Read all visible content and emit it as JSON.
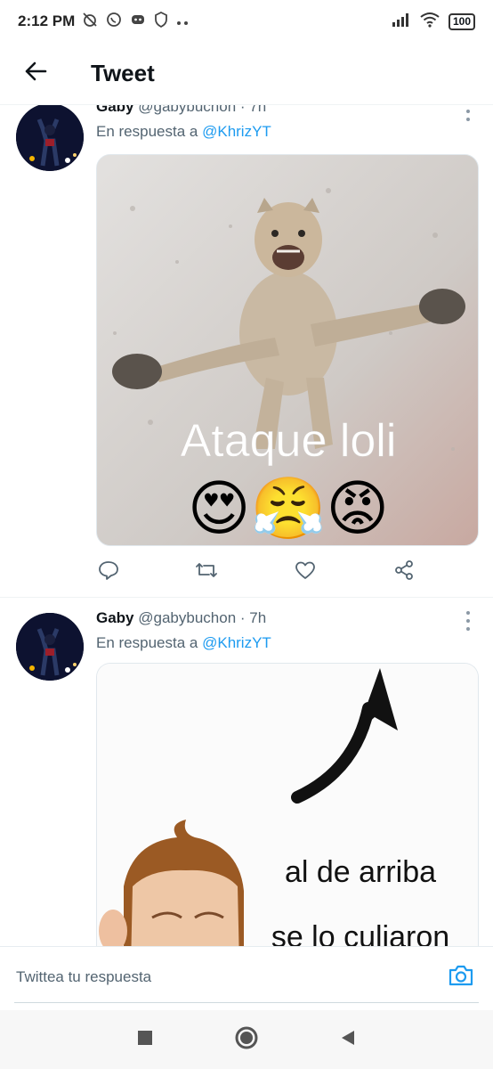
{
  "status_bar": {
    "time": "2:12 PM",
    "battery": "100"
  },
  "header": {
    "title": "Tweet"
  },
  "tweets": [
    {
      "author": "Gaby",
      "handle": "@gabybuchon",
      "time": "· 7h",
      "reply_prefix": "En respuesta a",
      "reply_to": "@KhrizYT",
      "image_caption": "Ataque loli",
      "image_emojis": "😍😤😡"
    },
    {
      "author": "Gaby",
      "handle": "@gabybuchon",
      "time": "· 7h",
      "reply_prefix": "En respuesta a",
      "reply_to": "@KhrizYT",
      "image_caption_line1": "al de arriba",
      "image_caption_line2": "se lo culiaron"
    }
  ],
  "reply_bar": {
    "placeholder": "Twittea tu respuesta"
  },
  "colors": {
    "accent": "#1d9bf0",
    "secondary_text": "#536471",
    "primary_text": "#0f1419"
  },
  "icons": [
    "back-arrow-icon",
    "reply-icon",
    "retweet-icon",
    "like-icon",
    "share-icon",
    "camera-icon",
    "more-icon"
  ]
}
